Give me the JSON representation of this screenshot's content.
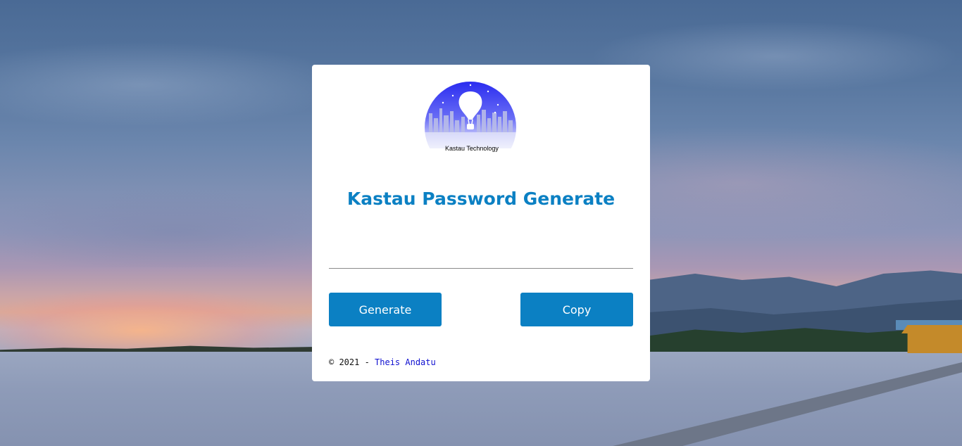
{
  "background": {
    "scene": "lake-sunset-pier"
  },
  "logo": {
    "caption": "Kastau Technology",
    "icon": "hot-air-balloon-city-logo"
  },
  "title": "Kastau Password Generate",
  "password_field": {
    "value": "",
    "placeholder": ""
  },
  "buttons": {
    "generate_label": "Generate",
    "copy_label": "Copy"
  },
  "footer": {
    "prefix": "© 2021 - ",
    "author": "Theis Andatu"
  },
  "colors": {
    "accent": "#0b80c3",
    "link": "#1010d0",
    "card": "#ffffff"
  }
}
